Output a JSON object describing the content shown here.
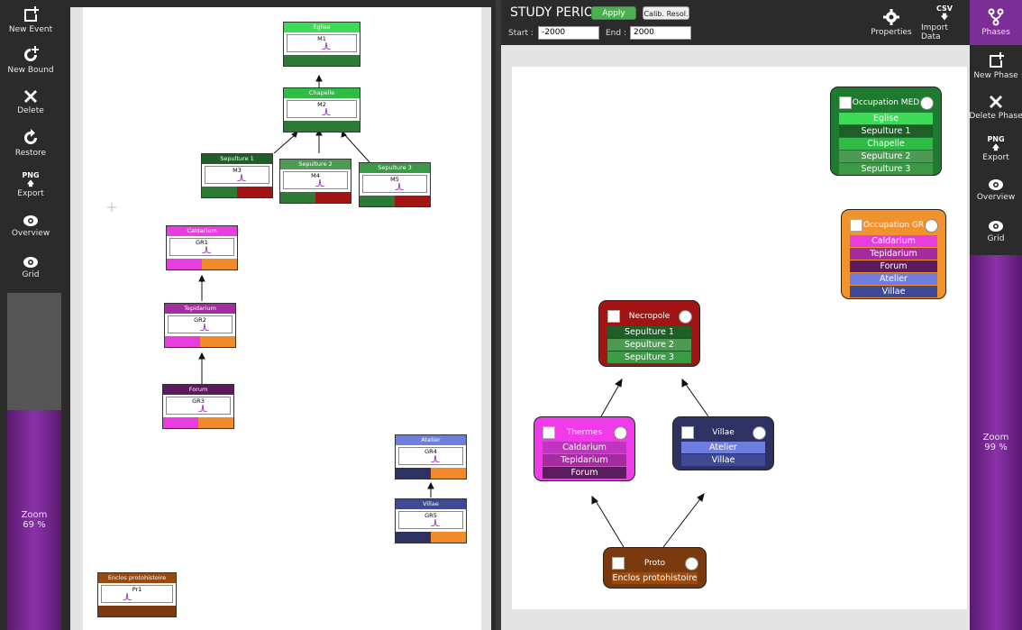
{
  "left_toolbar": {
    "items": [
      {
        "label": "New Event",
        "icon": "new-event-icon"
      },
      {
        "label": "New Bound",
        "icon": "new-bound-icon"
      },
      {
        "label": "Delete",
        "icon": "delete-icon"
      },
      {
        "label": "Restore",
        "icon": "restore-icon"
      },
      {
        "label": "Export",
        "icon": "export-png-icon",
        "glyph": "PNG"
      },
      {
        "label": "Overview",
        "icon": "eye-icon"
      },
      {
        "label": "Grid",
        "icon": "eye-icon"
      }
    ],
    "zoom_label": "Zoom",
    "zoom_value": "69 %"
  },
  "events": [
    {
      "name": "Eglise",
      "code": "M1",
      "header": "#3ddc56",
      "foot": [
        "#2d7a37"
      ]
    },
    {
      "name": "Chapelle",
      "code": "M2",
      "header": "#2fbc45",
      "foot": [
        "#2d7a37"
      ]
    },
    {
      "name": "Sepulture 1",
      "code": "M3",
      "header": "#1f5e27",
      "foot": [
        "#2d7a37",
        "#a31515"
      ]
    },
    {
      "name": "Sepulture 2",
      "code": "M4",
      "header": "#4e9a55",
      "foot": [
        "#2d7a37",
        "#a31515"
      ]
    },
    {
      "name": "Sepulture 3",
      "code": "M5",
      "header": "#3c9a47",
      "foot": [
        "#2d7a37",
        "#a31515"
      ]
    },
    {
      "name": "Caldarium",
      "code": "GR1",
      "header": "#e83ee0",
      "foot": [
        "#e83ee0",
        "#f08a2a"
      ]
    },
    {
      "name": "Tepidarium",
      "code": "GR2",
      "header": "#a62aa0",
      "foot": [
        "#e83ee0",
        "#f08a2a"
      ]
    },
    {
      "name": "Forum",
      "code": "GR3",
      "header": "#5e1a5e",
      "foot": [
        "#e83ee0",
        "#f08a2a"
      ]
    },
    {
      "name": "Atelier",
      "code": "GR4",
      "header": "#6e7ee0",
      "foot": [
        "#2e3262",
        "#f08a2a"
      ]
    },
    {
      "name": "Villae",
      "code": "GR5",
      "header": "#3e4a94",
      "foot": [
        "#2e3262",
        "#f08a2a"
      ]
    },
    {
      "name": "Enclos protohistoire",
      "code": "Pr1",
      "header": "#9a4a0e",
      "foot": [
        "#7a3a0e"
      ]
    }
  ],
  "study": {
    "title": "STUDY PERIOD",
    "apply_label": "Apply",
    "calib_label": "Calib. Resol.",
    "start_label": "Start :",
    "start_value": "-2000",
    "end_label": "End :",
    "end_value": "2000"
  },
  "top_tools": {
    "properties_label": "Properties",
    "import_label": "Import Data",
    "csv_glyph": "CSV"
  },
  "phases": [
    {
      "name": "Occupation MED",
      "bg": "#1e7a2e",
      "items": [
        {
          "t": "Eglise",
          "c": "#3ddc56"
        },
        {
          "t": "Sepulture 1",
          "c": "#1f5e27"
        },
        {
          "t": "Chapelle",
          "c": "#2fbc45"
        },
        {
          "t": "Sepulture 2",
          "c": "#4e9a55"
        },
        {
          "t": "Sepulture 3",
          "c": "#3c9a47"
        }
      ]
    },
    {
      "name": "Occupation GR",
      "bg": "#f0922e",
      "items": [
        {
          "t": "Caldarium",
          "c": "#e83ee0"
        },
        {
          "t": "Tepidarium",
          "c": "#a62aa0"
        },
        {
          "t": "Forum",
          "c": "#5e1a5e"
        },
        {
          "t": "Atelier",
          "c": "#6e7ee0"
        },
        {
          "t": "Villae",
          "c": "#3e4a94"
        }
      ]
    },
    {
      "name": "Necropole",
      "bg": "#a31515",
      "items": [
        {
          "t": "Sepulture 1",
          "c": "#1f5e27"
        },
        {
          "t": "Sepulture 2",
          "c": "#4e9a55"
        },
        {
          "t": "Sepulture 3",
          "c": "#3c9a47"
        }
      ]
    },
    {
      "name": "Thermes",
      "bg": "#f03ce8",
      "items": [
        {
          "t": "Caldarium",
          "c": "#c034c0"
        },
        {
          "t": "Tepidarium",
          "c": "#a62aa0"
        },
        {
          "t": "Forum",
          "c": "#5e1a5e"
        }
      ]
    },
    {
      "name": "Villae",
      "bg": "#2e3262",
      "items": [
        {
          "t": "Atelier",
          "c": "#6e7ee0"
        },
        {
          "t": "Villae",
          "c": "#3e4a94"
        }
      ]
    },
    {
      "name": "Proto",
      "bg": "#7a3a0e",
      "items": [
        {
          "t": "Enclos protohistoire",
          "c": "#9a4a0e"
        }
      ]
    }
  ],
  "right_toolbar": {
    "items": [
      {
        "label": "Phases",
        "icon": "phases-icon"
      },
      {
        "label": "New Phase",
        "icon": "new-phase-icon"
      },
      {
        "label": "Delete Phase",
        "icon": "delete-icon"
      },
      {
        "label": "Export",
        "icon": "export-png-icon",
        "glyph": "PNG"
      },
      {
        "label": "Overview",
        "icon": "eye-icon"
      },
      {
        "label": "Grid",
        "icon": "eye-icon"
      }
    ],
    "zoom_label": "Zoom",
    "zoom_value": "99 %"
  }
}
